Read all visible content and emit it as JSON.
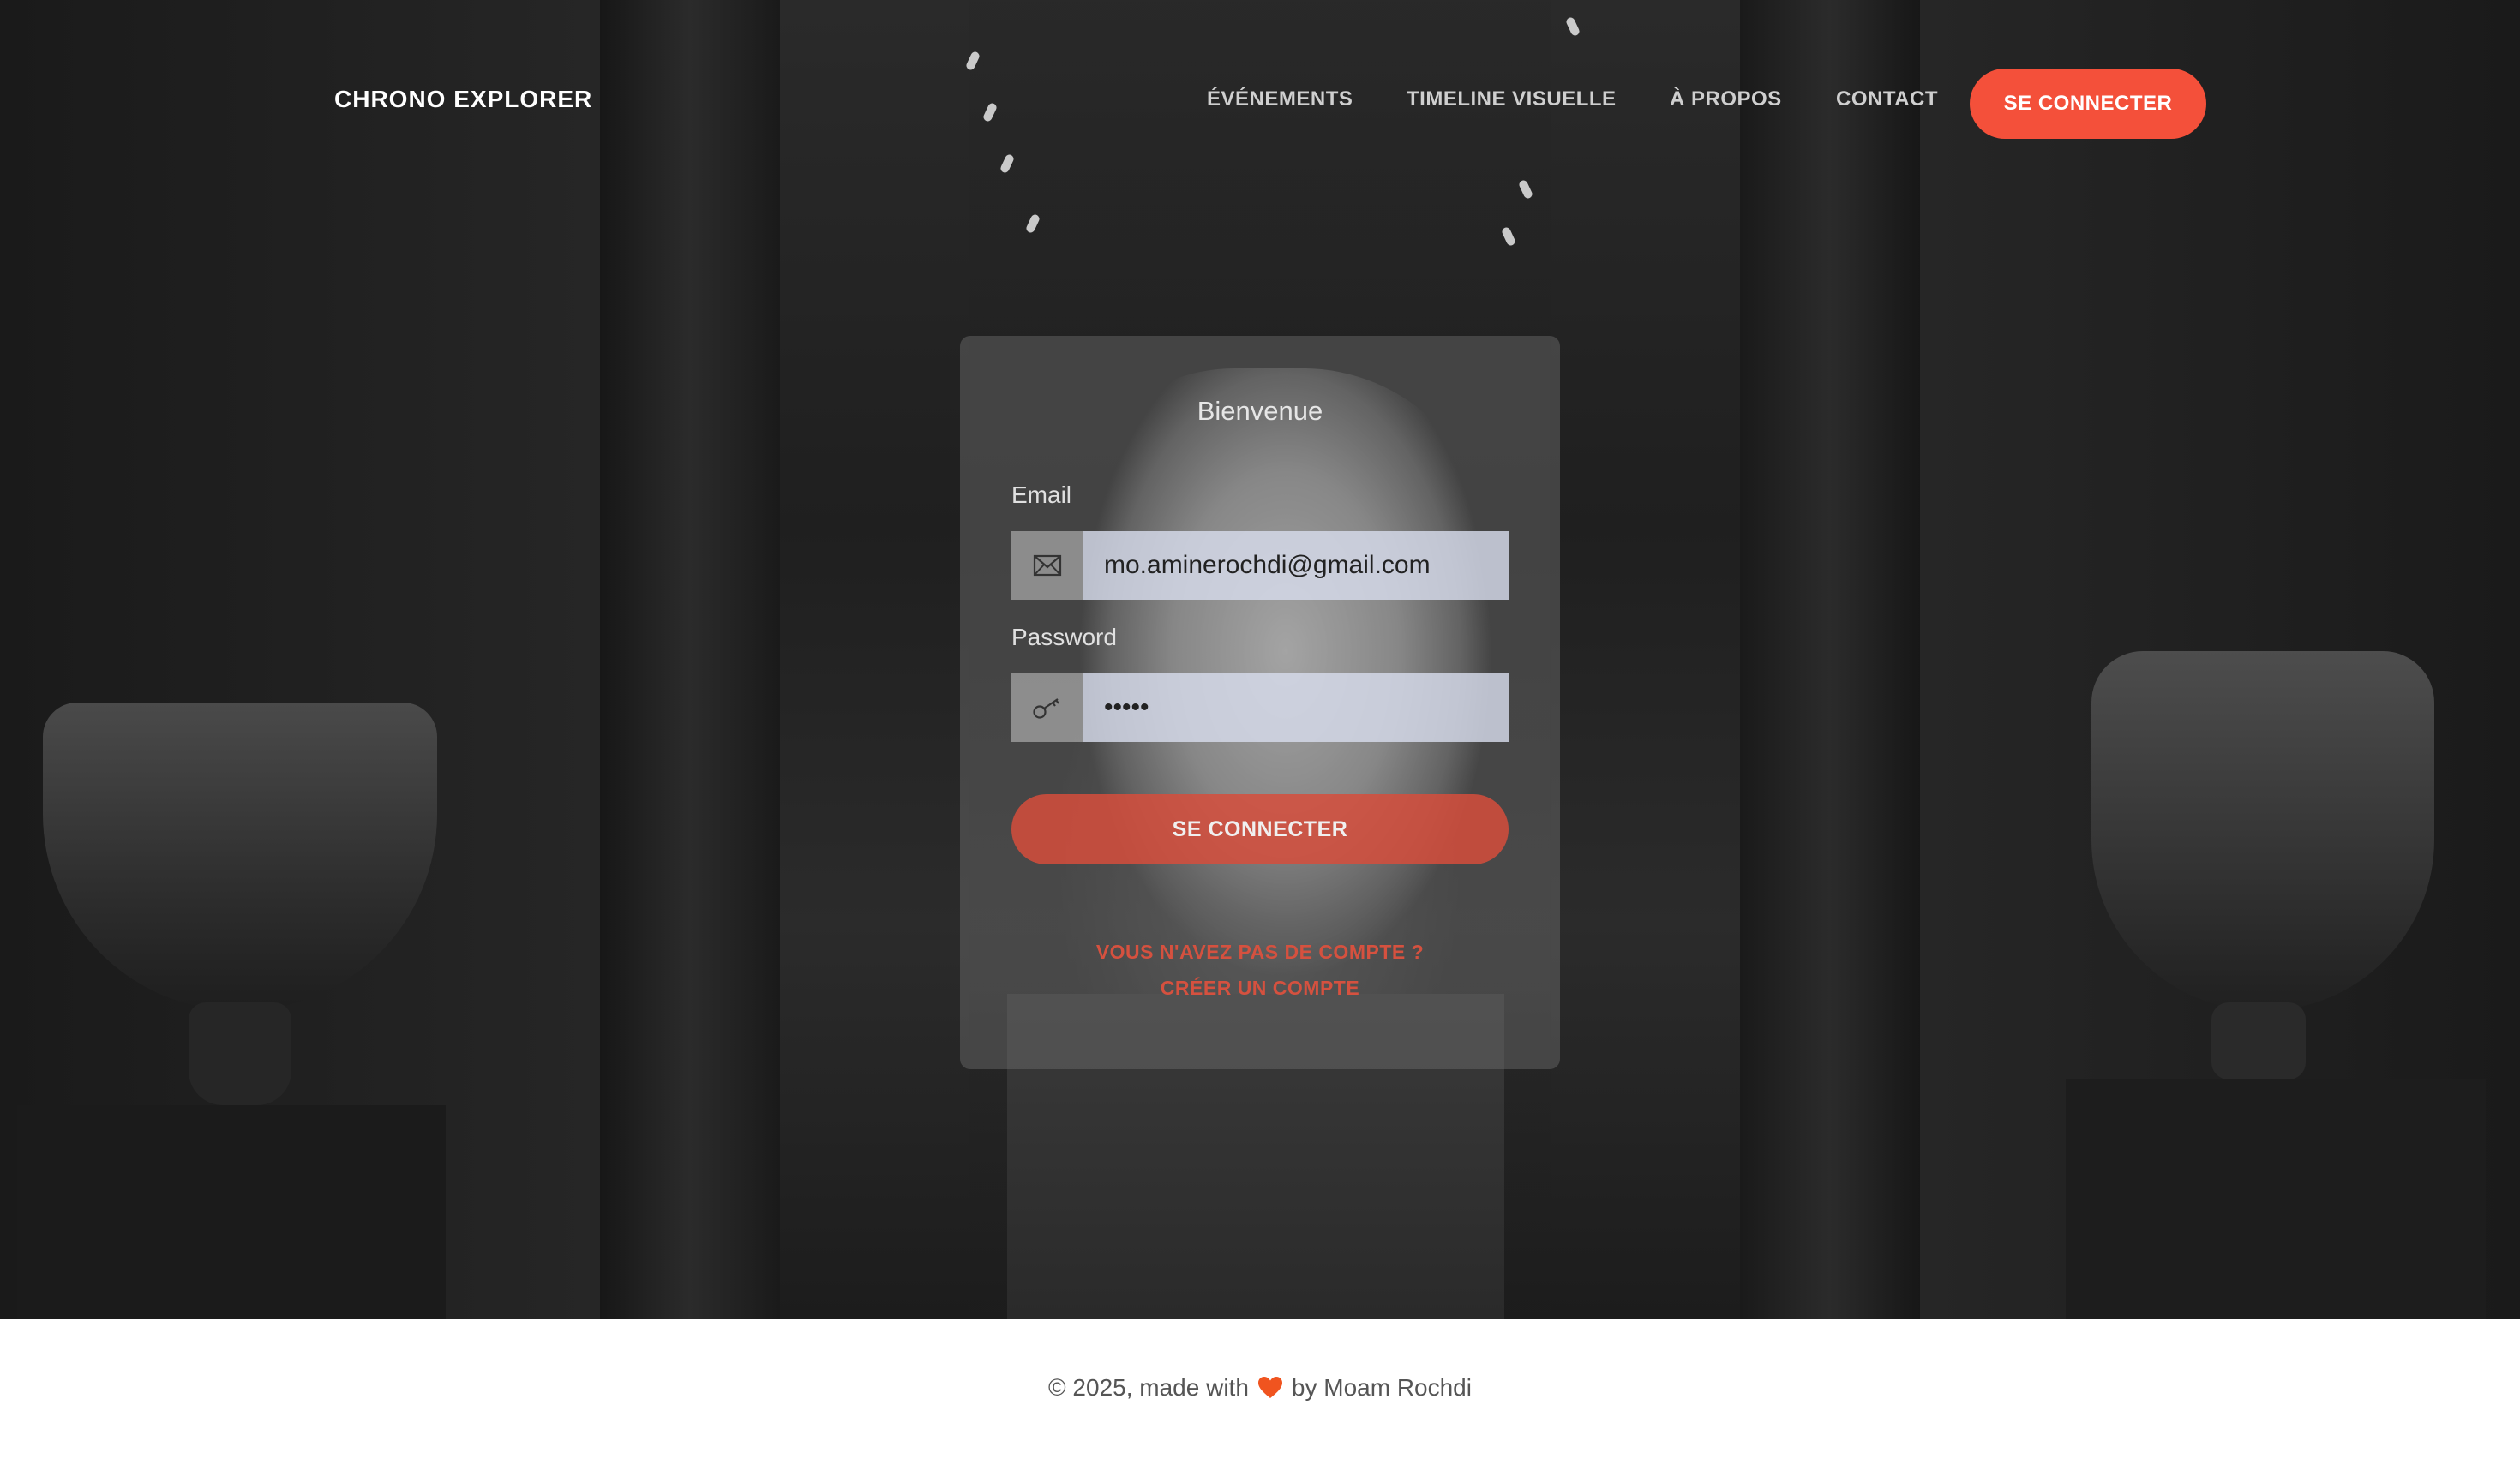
{
  "nav": {
    "brand": "CHRONO EXPLORER",
    "links": [
      {
        "label": "ÉVÉNEMENTS"
      },
      {
        "label": "TIMELINE VISUELLE"
      },
      {
        "label": "À PROPOS"
      },
      {
        "label": "CONTACT"
      }
    ],
    "cta_label": "SE CONNECTER"
  },
  "login": {
    "title": "Bienvenue",
    "email_label": "Email",
    "email_value": "mo.aminerochdi@gmail.com",
    "email_icon": "envelope-icon",
    "password_label": "Password",
    "password_value": "•••••",
    "password_icon": "key-icon",
    "submit_label": "SE CONNECTER",
    "signup_line1": "VOUS N'AVEZ PAS DE COMPTE ?",
    "signup_line2": "CRÉER UN COMPTE"
  },
  "footer": {
    "prefix": "© 2025, made with",
    "suffix": "by Moam Rochdi",
    "heart_icon": "heart-icon"
  },
  "colors": {
    "accent": "#f4503a",
    "card_bg": "rgba(110,110,110,0.45)",
    "footer_text": "#555555"
  }
}
